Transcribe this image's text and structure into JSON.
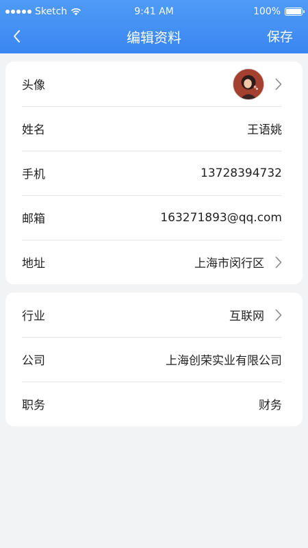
{
  "status_bar": {
    "carrier": "Sketch",
    "time": "9:41 AM",
    "battery": "100%",
    "battery_level": 1.0
  },
  "nav": {
    "title": "编辑资料",
    "save_label": "保存",
    "back_icon": "chevron-left-icon"
  },
  "profile": {
    "avatar_label": "头像",
    "name_label": "姓名",
    "name_value": "王语姚",
    "phone_label": "手机",
    "phone_value": "13728394732",
    "email_label": "邮箱",
    "email_value": "163271893@qq.com",
    "address_label": "地址",
    "address_value": "上海市闵行区"
  },
  "work": {
    "industry_label": "行业",
    "industry_value": "互联网",
    "company_label": "公司",
    "company_value": "上海创荣实业有限公司",
    "position_label": "职务",
    "position_value": "财务"
  },
  "colors": {
    "header": "#3a86f2",
    "background": "#f2f3f5",
    "card": "#ffffff"
  }
}
